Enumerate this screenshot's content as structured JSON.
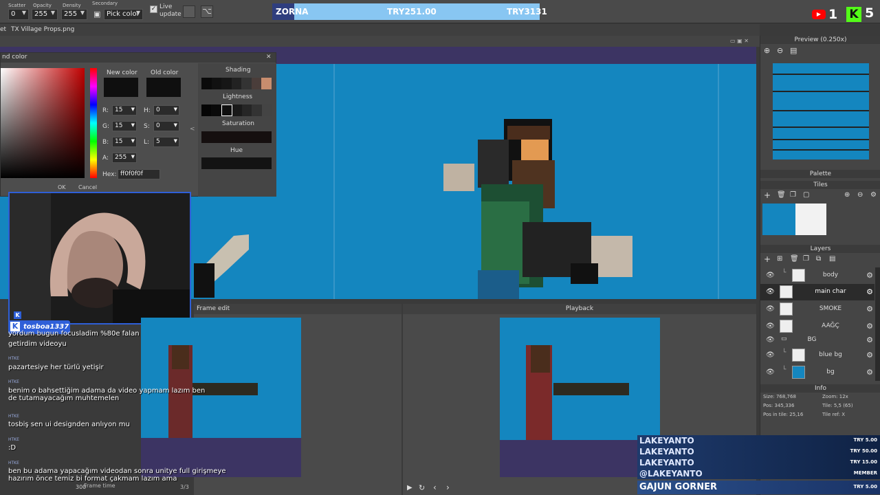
{
  "toolbar": {
    "scatter_label": "Scatter",
    "scatter_value": "0",
    "opacity_label": "Opacity",
    "opacity_value": "255",
    "density_label": "Density",
    "density_value": "255",
    "secondary_label": "Secondary",
    "secondary_value": "Pick color",
    "live_label_1": "Live",
    "live_label_2": "update"
  },
  "donation_bar": {
    "name": "ZORNA",
    "amount": "TRY251.00",
    "goal": "TRY3131"
  },
  "top_right": {
    "youtube_count": "1",
    "kick_count": "5"
  },
  "tabs": {
    "prefix": "et",
    "file": "TX Village Props.png"
  },
  "color_dialog": {
    "title": "nd color",
    "new_color_label": "New color",
    "old_color_label": "Old color",
    "r": "15",
    "g": "15",
    "b": "15",
    "a": "255",
    "h": "0",
    "s": "0",
    "l": "5",
    "hex_label": "Hex:",
    "hex": "ff0f0f0f",
    "shading_label": "Shading",
    "lightness_label": "Lightness",
    "saturation_label": "Saturation",
    "hue_label": "Hue",
    "ok": "OK",
    "cancel": "Cancel",
    "new_color": "#0f0f0f",
    "old_color": "#0f0f0f"
  },
  "webcam": {
    "handle": "tosboa1337"
  },
  "frame_edit": {
    "title": "Frame edit",
    "frame_time_label": "Frame time",
    "frame_time": "300",
    "frame_counter": "3/3"
  },
  "playback": {
    "title": "Playback"
  },
  "chat": [
    {
      "user": "",
      "text": "yordum bugun focusladim %80e falan"
    },
    {
      "user": "",
      "text": "getirdim videoyu"
    },
    {
      "user": "HTKE",
      "text": "pazartesiye her türlü yetişir"
    },
    {
      "user": "HTKE",
      "text": "benim o bahsettiğim adama da video yapmam lazım ben de tutamayacağım muhtemelen"
    },
    {
      "user": "HTKE",
      "text": "tosbiş sen ui designden anlıyon mu"
    },
    {
      "user": "HTKE",
      "text": ":D"
    },
    {
      "user": "HTKE",
      "text": "ben bu adama yapacağım videodan sonra unitye full girişmeye hazırım önce temiz bi format çakmam lazım ama"
    }
  ],
  "right_panel": {
    "preview_title": "Preview (0.250x)",
    "palette_title": "Palette",
    "tiles_title": "Tiles",
    "layers_title": "Layers",
    "layers": [
      {
        "name": "body",
        "indent": true,
        "selected": false
      },
      {
        "name": "main char",
        "indent": false,
        "selected": true
      },
      {
        "name": "SMOKE",
        "indent": false,
        "selected": false
      },
      {
        "name": "AAĞÇ",
        "indent": false,
        "selected": false
      },
      {
        "name": "BG",
        "indent": false,
        "selected": false,
        "folder": true
      },
      {
        "name": "blue bg",
        "indent": true,
        "selected": false
      },
      {
        "name": "bg",
        "indent": true,
        "selected": false
      }
    ],
    "info_title": "Info",
    "info": {
      "size": "Size: 768,768",
      "zoom": "Zoom: 12x",
      "pos": "Pos: 345,336",
      "tile": "Tile: 5,5 (65)",
      "pos_in_tile": "Pos in tile: 25,16",
      "tile_ref": "Tile ref: X"
    }
  },
  "donations": [
    {
      "name": "LAKEYANTO",
      "amount": "TRY 5.00"
    },
    {
      "name": "LAKEYANTO",
      "amount": "TRY 50.00"
    },
    {
      "name": "LAKEYANTO",
      "amount": "TRY 15.00"
    },
    {
      "name": "@LAKEYANTO",
      "amount": "MEMBER"
    },
    {
      "name": "GAJUN GORNER",
      "amount": "TRY 5.00"
    }
  ],
  "colors": {
    "canvas_bg": "#1486bf",
    "webcam_border": "#2e5fd8",
    "kick_green": "#53fc18",
    "youtube_red": "#ff0000"
  }
}
